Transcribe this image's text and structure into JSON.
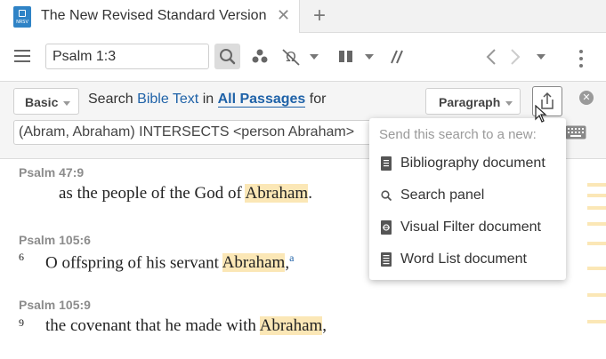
{
  "tab": {
    "title": "The New Revised Standard Version",
    "book_badge": "NRSV",
    "close_glyph": "✕",
    "add_glyph": "+"
  },
  "toolbar": {
    "reference_value": "Psalm 1:3",
    "icons": [
      "menu-icon",
      "search-icon",
      "people-icon",
      "omega-filter-icon",
      "parallel-columns-icon",
      "parallel-slash-icon",
      "back-icon",
      "forward-icon",
      "history-icon",
      "more-icon"
    ]
  },
  "search": {
    "mode_label": "Basic",
    "sentence_prefix": "Search",
    "scope_label": "Bible Text",
    "in_word": "in",
    "range_label": "All Passages",
    "for_word": "for",
    "layout_label": "Paragraph",
    "clear_glyph": "✕",
    "query_value": "(Abram, Abraham) INTERSECTS <person Abraham>"
  },
  "results": [
    {
      "reference": "Psalm 47:9",
      "verse_number": "",
      "text_before": "as the people of the God of ",
      "highlight": "Abraham",
      "text_after": ".",
      "footnote": ""
    },
    {
      "reference": "Psalm 105:6",
      "verse_number": "6",
      "text_before": "O offspring of his servant ",
      "highlight": "Abraham",
      "text_after": ",",
      "footnote": "a"
    },
    {
      "reference": "Psalm 105:9",
      "verse_number": "9",
      "text_before": "the covenant that he made with ",
      "highlight": "Abraham",
      "text_after": ",",
      "footnote": ""
    }
  ],
  "dropdown": {
    "header": "Send this search to a new:",
    "items": [
      {
        "label": "Bibliography document",
        "icon": "document-icon"
      },
      {
        "label": "Search panel",
        "icon": "search-icon"
      },
      {
        "label": "Visual Filter document",
        "icon": "visual-filter-icon"
      },
      {
        "label": "Word List document",
        "icon": "word-list-icon"
      }
    ]
  },
  "colors": {
    "highlight": "#fbe7b6",
    "link": "#1f62a8",
    "book_badge": "#2f83c6"
  }
}
